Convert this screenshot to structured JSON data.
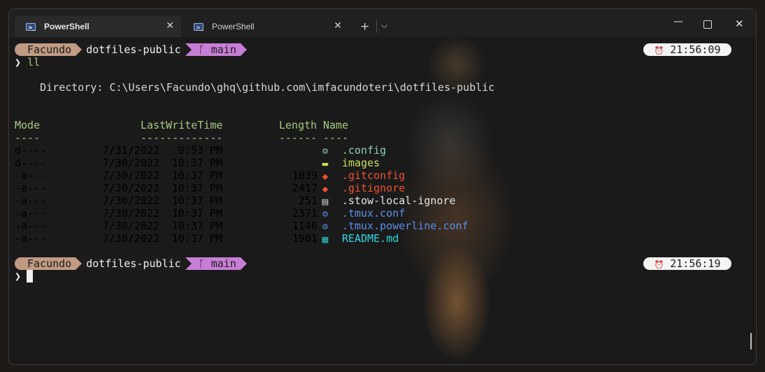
{
  "tabs": [
    {
      "label": "PowerShell",
      "active": true,
      "icon": "powershell-icon"
    },
    {
      "label": "PowerShell",
      "active": false,
      "icon": "powershell-icon"
    }
  ],
  "window_controls": {
    "new_tab": "+",
    "dropdown": "⌵",
    "minimize": "—",
    "close": "✕"
  },
  "prompt1": {
    "user": "Facundo",
    "dir": "dotfiles-public",
    "branch": "main",
    "time": "21:56:09",
    "command": "ll"
  },
  "directory_line": "    Directory: C:\\Users\\Facundo\\ghq\\github.com\\imfacundoteri\\dotfiles-public",
  "headers": {
    "mode": "Mode",
    "time": "LastWriteTime",
    "length": "Length",
    "name": "Name"
  },
  "underlines": {
    "mode": "----",
    "time": "-------------",
    "length": "------",
    "name": "----"
  },
  "rows": [
    {
      "mode": "d----",
      "date": "7/31/2022",
      "time": "9:53 PM",
      "length": "",
      "name": ".config",
      "icon": "gear-icon",
      "color": "#8fd0b8"
    },
    {
      "mode": "d----",
      "date": "7/30/2022",
      "time": "10:37 PM",
      "length": "",
      "name": "images",
      "icon": "folder-icon",
      "color": "#c8e05a"
    },
    {
      "mode": "-a---",
      "date": "7/30/2022",
      "time": "10:37 PM",
      "length": "1039",
      "name": ".gitconfig",
      "icon": "git-icon",
      "color": "#f0522c"
    },
    {
      "mode": "-a---",
      "date": "7/30/2022",
      "time": "10:37 PM",
      "length": "2417",
      "name": ".gitignore",
      "icon": "git-icon",
      "color": "#f0522c"
    },
    {
      "mode": "-a---",
      "date": "7/30/2022",
      "time": "10:37 PM",
      "length": "251",
      "name": ".stow-local-ignore",
      "icon": "file-icon",
      "color": "#e6e6e6"
    },
    {
      "mode": "-a---",
      "date": "7/30/2022",
      "time": "10:37 PM",
      "length": "2371",
      "name": ".tmux.conf",
      "icon": "gear-icon",
      "color": "#5c8ee6"
    },
    {
      "mode": "-a---",
      "date": "7/30/2022",
      "time": "10:37 PM",
      "length": "1146",
      "name": ".tmux.powerline.conf",
      "icon": "gear-icon",
      "color": "#5c8ee6"
    },
    {
      "mode": "-a---",
      "date": "7/30/2022",
      "time": "10:37 PM",
      "length": "1901",
      "name": "README.md",
      "icon": "markdown-icon",
      "color": "#2fd6e0"
    }
  ],
  "prompt2": {
    "user": "Facundo",
    "dir": "dotfiles-public",
    "branch": "main",
    "time": "21:56:19"
  },
  "glyphs": {
    "prompt": "❯",
    "branch": "ᚴ",
    "clock": "⏰",
    "gear": "⚙",
    "folder": "▬",
    "git": "◆",
    "file": "▤",
    "markdown": "▦"
  }
}
